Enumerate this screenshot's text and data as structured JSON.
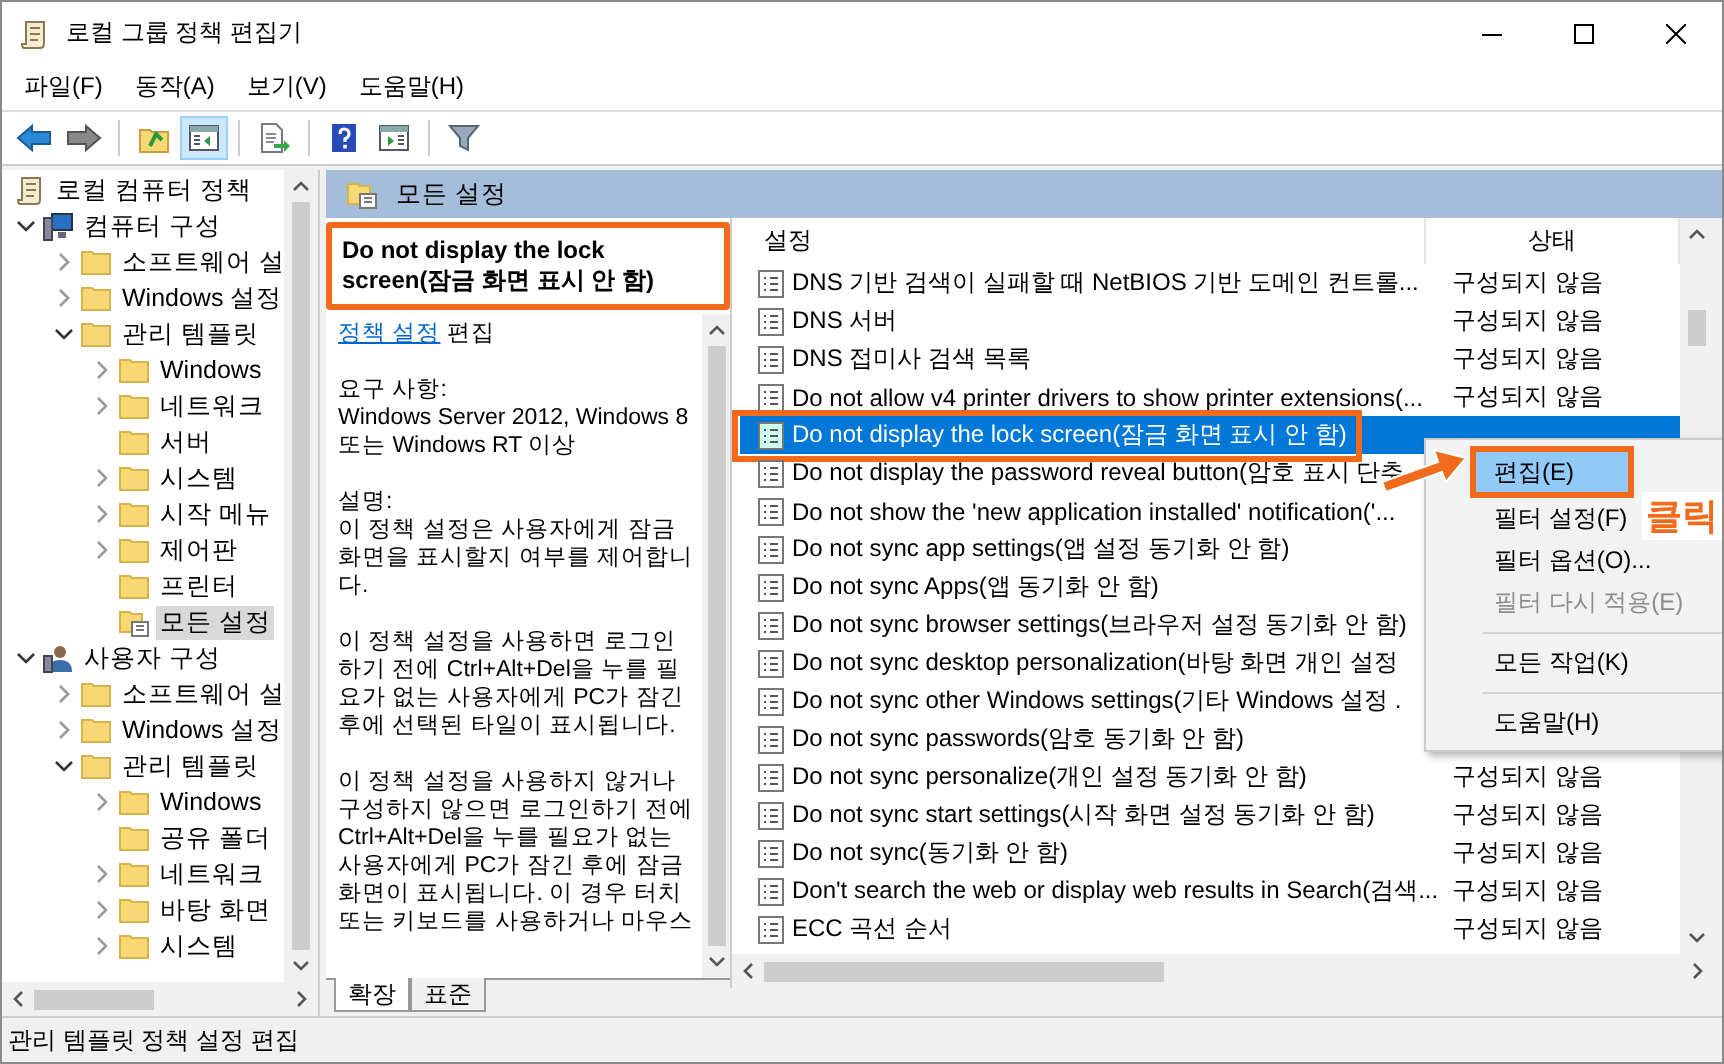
{
  "window": {
    "title": "로컬 그룹 정책 편집기"
  },
  "menu": [
    "파일(F)",
    "동작(A)",
    "보기(V)",
    "도움말(H)"
  ],
  "toolbar": [
    {
      "kind": "back",
      "pressed": false
    },
    {
      "kind": "forward",
      "pressed": false
    },
    {
      "kind": "separator"
    },
    {
      "kind": "up",
      "pressed": false
    },
    {
      "kind": "tree-toggle",
      "pressed": true
    },
    {
      "kind": "separator"
    },
    {
      "kind": "export",
      "pressed": false
    },
    {
      "kind": "separator"
    },
    {
      "kind": "help",
      "pressed": false
    },
    {
      "kind": "pane-toggle",
      "pressed": false
    },
    {
      "kind": "separator"
    },
    {
      "kind": "filter",
      "pressed": false
    }
  ],
  "tree": {
    "items": [
      {
        "label": "로컬 컴퓨터 정책",
        "kind": "policy",
        "selected": false,
        "children": [
          {
            "label": "컴퓨터 구성",
            "kind": "computer",
            "expanded": true,
            "selected": false,
            "children": [
              {
                "label": "소프트웨어 설",
                "kind": "folder",
                "expanded": false,
                "selected": false
              },
              {
                "label": "Windows 설정",
                "kind": "folder",
                "expanded": false,
                "selected": false
              },
              {
                "label": "관리 템플릿",
                "kind": "folder",
                "expanded": true,
                "selected": false,
                "children": [
                  {
                    "label": "Windows",
                    "kind": "folder",
                    "expanded": false,
                    "selected": false
                  },
                  {
                    "label": "네트워크",
                    "kind": "folder",
                    "expanded": false,
                    "selected": false
                  },
                  {
                    "label": "서버",
                    "kind": "folder",
                    "selected": false
                  },
                  {
                    "label": "시스템",
                    "kind": "folder",
                    "expanded": false,
                    "selected": false
                  },
                  {
                    "label": "시작 메뉴",
                    "kind": "folder",
                    "expanded": false,
                    "selected": false
                  },
                  {
                    "label": "제어판",
                    "kind": "folder",
                    "expanded": false,
                    "selected": false
                  },
                  {
                    "label": "프린터",
                    "kind": "folder",
                    "selected": false
                  },
                  {
                    "label": "모든 설정",
                    "kind": "settings",
                    "selected": true
                  }
                ]
              }
            ]
          },
          {
            "label": "사용자 구성",
            "kind": "user",
            "expanded": true,
            "selected": false,
            "children": [
              {
                "label": "소프트웨어 설",
                "kind": "folder",
                "expanded": false,
                "selected": false
              },
              {
                "label": "Windows 설정",
                "kind": "folder",
                "expanded": false,
                "selected": false
              },
              {
                "label": "관리 템플릿",
                "kind": "folder",
                "expanded": true,
                "selected": false,
                "children": [
                  {
                    "label": "Windows",
                    "kind": "folder",
                    "expanded": false,
                    "selected": false
                  },
                  {
                    "label": "공유 폴더",
                    "kind": "folder",
                    "selected": false
                  },
                  {
                    "label": "네트워크",
                    "kind": "folder",
                    "expanded": false,
                    "selected": false
                  },
                  {
                    "label": "바탕 화면",
                    "kind": "folder",
                    "expanded": false,
                    "selected": false
                  },
                  {
                    "label": "시스템",
                    "kind": "folder",
                    "expanded": false,
                    "selected": false
                  }
                ]
              }
            ]
          }
        ]
      }
    ]
  },
  "header": {
    "title": "모든 설정"
  },
  "description": {
    "title": "Do not display the lock screen(잠금 화면 표시 안 함)",
    "highlighted": true,
    "link": "정책 설정",
    "link_suffix": "편집",
    "requirements_label": "요구 사항:",
    "requirements": "Windows Server 2012, Windows 8 또는 Windows RT 이상",
    "description_label": "설명:",
    "paragraphs": [
      "이 정책 설정은 사용자에게 잠금 화면을 표시할지 여부를 제어합니다.",
      "이 정책 설정을 사용하면 로그인하기 전에 Ctrl+Alt+Del을 누를 필요가 없는 사용자에게 PC가 잠긴 후에 선택된 타일이 표시됩니다.",
      "이 정책 설정을 사용하지 않거나 구성하지 않으면 로그인하기 전에 Ctrl+Alt+Del을 누를 필요가 없는 사용자에게 PC가 잠긴 후에 잠금 화면이 표시됩니다. 이 경우 터치 또는 키보드를 사용하거나 마우스"
    ]
  },
  "view_tabs": [
    {
      "label": "확장",
      "selected": true
    },
    {
      "label": "표준",
      "selected": false
    }
  ],
  "table": {
    "columns": [
      "설정",
      "상태"
    ],
    "rows": [
      {
        "name": "DNS 기반 검색이 실패할 때 NetBIOS 기반 도메인 컨트롤...",
        "status": "구성되지 않음",
        "selected": false
      },
      {
        "name": "DNS 서버",
        "status": "구성되지 않음",
        "selected": false
      },
      {
        "name": "DNS 접미사 검색 목록",
        "status": "구성되지 않음",
        "selected": false
      },
      {
        "name": "Do not allow v4 printer drivers to show printer extensions(...",
        "status": "구성되지 않음",
        "selected": false
      },
      {
        "name": "Do not display the lock screen(잠금 화면 표시 안 함)",
        "selected": true,
        "highlighted": true
      },
      {
        "name": "Do not display the password reveal button(암호 표시 단추",
        "selected": false
      },
      {
        "name": "Do not show the 'new application installed' notification('...",
        "selected": false
      },
      {
        "name": "Do not sync app settings(앱 설정 동기화 안 함)",
        "selected": false
      },
      {
        "name": "Do not sync Apps(앱 동기화 안 함)",
        "selected": false
      },
      {
        "name": "Do not sync browser settings(브라우저 설정 동기화 안 함)",
        "selected": false
      },
      {
        "name": "Do not sync desktop personalization(바탕 화면 개인 설정",
        "selected": false
      },
      {
        "name": "Do not sync other Windows settings(기타 Windows 설정 .",
        "selected": false
      },
      {
        "name": "Do not sync passwords(암호 동기화 안 함)",
        "selected": false
      },
      {
        "name": "Do not sync personalize(개인 설정 동기화 안 함)",
        "status": "구성되지 않음",
        "selected": false
      },
      {
        "name": "Do not sync start settings(시작 화면 설정 동기화 안 함)",
        "status": "구성되지 않음",
        "selected": false
      },
      {
        "name": "Do not sync(동기화 안 함)",
        "status": "구성되지 않음",
        "selected": false
      },
      {
        "name": "Don't search the web or display web results in Search(검색...",
        "status": "구성되지 않음",
        "selected": false
      },
      {
        "name": "ECC 곡선 순서",
        "status": "구성되지 않음",
        "selected": false
      }
    ]
  },
  "context_menu": {
    "items": [
      {
        "kind": "item",
        "label": "편집(E)",
        "selected": true,
        "disabled": false,
        "highlighted": true
      },
      {
        "kind": "item",
        "label": "필터 설정(F)",
        "selected": false,
        "disabled": false
      },
      {
        "kind": "item",
        "label": "필터 옵션(O)...",
        "selected": false,
        "disabled": false
      },
      {
        "kind": "item",
        "label": "필터 다시 적용(E)",
        "selected": false,
        "disabled": true
      },
      {
        "kind": "separator"
      },
      {
        "kind": "item",
        "label": "모든 작업(K)",
        "selected": false,
        "disabled": false
      },
      {
        "kind": "separator"
      },
      {
        "kind": "item",
        "label": "도움말(H)",
        "selected": false,
        "disabled": false
      }
    ]
  },
  "annotation": {
    "text": "클릭"
  },
  "status_bar": {
    "text": "관리 템플릿 정책 설정 편집"
  }
}
